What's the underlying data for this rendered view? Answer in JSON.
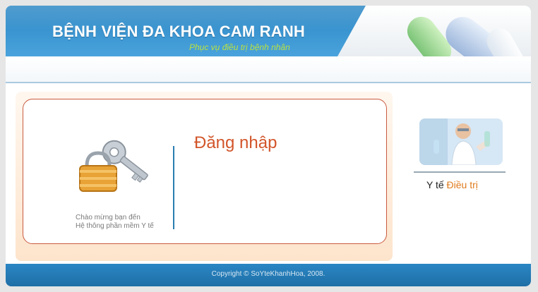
{
  "header": {
    "title": "BỆNH VIỆN ĐA KHOA CAM RANH",
    "subtitle": "Phục vụ điều trị bệnh nhân"
  },
  "login": {
    "title": "Đăng nhập",
    "welcome_line1": "Chào mừng bạn đến",
    "welcome_line2": "Hệ thông phần mềm Y tế",
    "icon": "lock-key-icon"
  },
  "sidebar": {
    "label_prefix": "Y tế",
    "label_highlight": "Điều trị",
    "image": "lab-scientist-photo"
  },
  "footer": {
    "copyright": "Copyright © SoYteKhanhHoa, 2008."
  },
  "colors": {
    "header_blue": "#2a86c4",
    "subtitle_green": "#b9e041",
    "login_title_orange": "#d2552a",
    "divider_blue": "#2a7db0",
    "border_red": "#c95a3f",
    "highlight_orange": "#e07b1c"
  }
}
